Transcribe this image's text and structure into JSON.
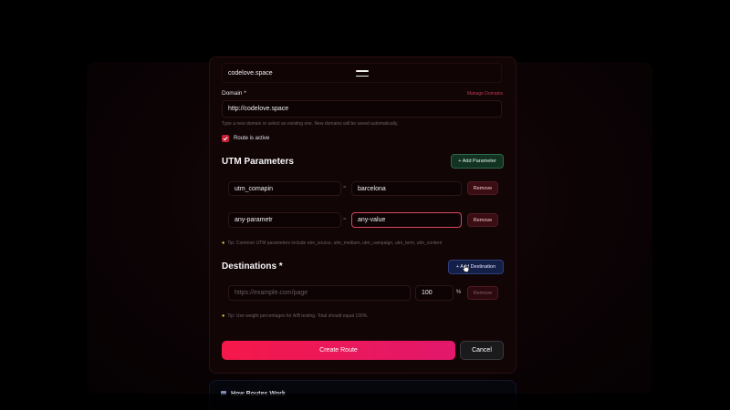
{
  "top_field": {
    "value": "codelove.space"
  },
  "domain": {
    "label": "Domain *",
    "manage_link": "Manage Domains",
    "value": "http://codelove.space",
    "hint": "Type a new domain or select an existing one. New domains will be saved automatically."
  },
  "active_checkbox": {
    "label": "Route is active",
    "checked": true
  },
  "utm": {
    "title": "UTM Parameters",
    "add_button": "+ Add Parameter",
    "rows": [
      {
        "key": "utm_comapin",
        "value": "barcelona",
        "equals": "=",
        "remove": "Remove"
      },
      {
        "key": "any-parametr",
        "value": "any-value",
        "equals": "=",
        "remove": "Remove"
      }
    ],
    "tip": "Tip: Common UTM parameters include utm_source, utm_medium, utm_campaign, utm_term, utm_content"
  },
  "destinations": {
    "title": "Destinations *",
    "add_button": "+ Add Destination",
    "row": {
      "url_placeholder": "https://example.com/page",
      "weight": "100",
      "percent": "%",
      "remove": "Remove"
    },
    "tip": "Tip: Use weight percentages for A/B testing. Total should equal 100%."
  },
  "actions": {
    "create": "Create Route",
    "cancel": "Cancel"
  },
  "how_card": {
    "title": "How Routes Work",
    "icon": "book-icon"
  },
  "colors": {
    "accent_create_start": "#f5184a",
    "accent_create_end": "#e2186c",
    "add_parameter": "#123321",
    "add_destination": "#141f47",
    "remove": "#3a0d13"
  }
}
